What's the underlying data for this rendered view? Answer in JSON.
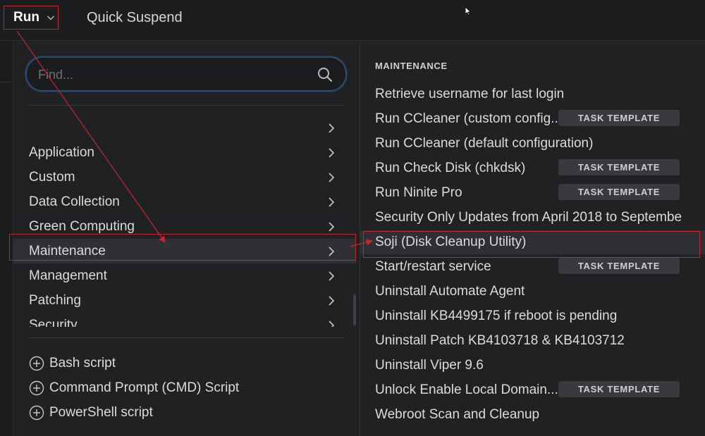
{
  "topbar": {
    "run_label": "Run",
    "quick_suspend_label": "Quick Suspend"
  },
  "search": {
    "placeholder": "Find...",
    "value": ""
  },
  "categories": [
    {
      "label": ""
    },
    {
      "label": "Application"
    },
    {
      "label": "Custom"
    },
    {
      "label": "Data Collection"
    },
    {
      "label": "Green Computing"
    },
    {
      "label": "Maintenance",
      "selected": true
    },
    {
      "label": "Management"
    },
    {
      "label": "Patching"
    },
    {
      "label": "Security"
    }
  ],
  "scripts": [
    {
      "label": "Bash script"
    },
    {
      "label": "Command Prompt (CMD) Script"
    },
    {
      "label": "PowerShell script"
    }
  ],
  "right_pane": {
    "section_title": "MAINTENANCE",
    "badge_label": "TASK TEMPLATE",
    "tasks": [
      {
        "label": "Retrieve username for last login"
      },
      {
        "label": "Run CCleaner (custom config...",
        "badge": true
      },
      {
        "label": "Run CCleaner (default configuration)"
      },
      {
        "label": "Run Check Disk (chkdsk)",
        "badge": true
      },
      {
        "label": "Run Ninite Pro",
        "badge": true
      },
      {
        "label": "Security Only Updates from April 2018 to Septembe"
      },
      {
        "label": "Soji (Disk Cleanup Utility)",
        "selected": true
      },
      {
        "label": "Start/restart service",
        "badge": true
      },
      {
        "label": "Uninstall Automate Agent"
      },
      {
        "label": "Uninstall KB4499175 if reboot is pending"
      },
      {
        "label": "Uninstall Patch KB4103718 & KB4103712"
      },
      {
        "label": "Uninstall Viper 9.6"
      },
      {
        "label": "Unlock Enable Local Domain...",
        "badge": true
      },
      {
        "label": "Webroot Scan and Cleanup"
      }
    ]
  },
  "colors": {
    "annotation_red": "#c3262b",
    "search_border": "#2c4c70",
    "background": "#202123"
  },
  "icons": [
    "chevron-down-icon",
    "search-icon",
    "chevron-right-icon",
    "plus-circle-icon",
    "mouse-cursor-icon"
  ]
}
